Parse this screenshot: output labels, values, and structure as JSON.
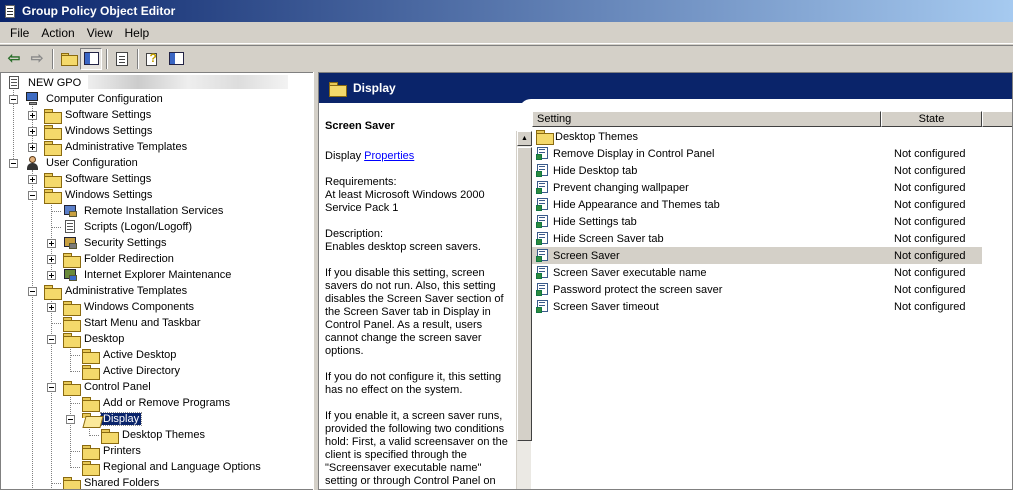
{
  "window": {
    "title": "Group Policy Object Editor"
  },
  "menu": [
    {
      "label": "File"
    },
    {
      "label": "Action"
    },
    {
      "label": "View"
    },
    {
      "label": "Help"
    }
  ],
  "toolbar": {
    "buttons": [
      "back-icon",
      "forward-icon",
      "up-folder-icon",
      "show-hide-tree-icon",
      "export-list-icon",
      "help-icon",
      "properties-icon"
    ]
  },
  "tree": {
    "root": "NEW GPO",
    "items": [
      {
        "label": "Computer Configuration"
      },
      {
        "label": "Software Settings"
      },
      {
        "label": "Windows Settings"
      },
      {
        "label": "Administrative Templates"
      },
      {
        "label": "User Configuration"
      },
      {
        "label": "Software Settings"
      },
      {
        "label": "Windows Settings"
      },
      {
        "label": "Remote Installation Services"
      },
      {
        "label": "Scripts (Logon/Logoff)"
      },
      {
        "label": "Security Settings"
      },
      {
        "label": "Folder Redirection"
      },
      {
        "label": "Internet Explorer Maintenance"
      },
      {
        "label": "Administrative Templates"
      },
      {
        "label": "Windows Components"
      },
      {
        "label": "Start Menu and Taskbar"
      },
      {
        "label": "Desktop"
      },
      {
        "label": "Active Desktop"
      },
      {
        "label": "Active Directory"
      },
      {
        "label": "Control Panel"
      },
      {
        "label": "Add or Remove Programs"
      },
      {
        "label": "Display"
      },
      {
        "label": "Desktop Themes"
      },
      {
        "label": "Printers"
      },
      {
        "label": "Regional and Language Options"
      },
      {
        "label": "Shared Folders"
      }
    ]
  },
  "details": {
    "header": "Display",
    "setting_title": "Screen Saver",
    "display_prefix": "Display",
    "properties_link": "Properties",
    "requirements_label": "Requirements:",
    "requirements_text": "At least Microsoft Windows 2000 Service Pack 1",
    "description_label": "Description:",
    "description_text": "Enables desktop screen savers.",
    "para1": "If you disable this setting, screen savers do not run. Also, this setting disables the Screen Saver section of the Screen Saver tab in Display in Control Panel. As a result, users cannot change the screen saver options.",
    "para2": "If you do not configure it, this setting has no effect on the system.",
    "para3": "If you enable it, a screen saver runs, provided the following two conditions hold: First, a valid screensaver on the client is specified through the \"Screensaver executable name\" setting or through Control Panel on the client computer. Second, the"
  },
  "list": {
    "columns": [
      "Setting",
      "State"
    ],
    "rows": [
      {
        "name": "Desktop Themes",
        "state": "",
        "type": "folder"
      },
      {
        "name": "Remove Display in Control Panel",
        "state": "Not configured",
        "type": "setting"
      },
      {
        "name": "Hide Desktop tab",
        "state": "Not configured",
        "type": "setting"
      },
      {
        "name": "Prevent changing wallpaper",
        "state": "Not configured",
        "type": "setting"
      },
      {
        "name": "Hide Appearance and Themes tab",
        "state": "Not configured",
        "type": "setting"
      },
      {
        "name": "Hide Settings tab",
        "state": "Not configured",
        "type": "setting"
      },
      {
        "name": "Hide Screen Saver tab",
        "state": "Not configured",
        "type": "setting"
      },
      {
        "name": "Screen Saver",
        "state": "Not configured",
        "type": "setting"
      },
      {
        "name": "Screen Saver executable name",
        "state": "Not configured",
        "type": "setting"
      },
      {
        "name": "Password protect the screen saver",
        "state": "Not configured",
        "type": "setting"
      },
      {
        "name": "Screen Saver timeout",
        "state": "Not configured",
        "type": "setting"
      }
    ]
  }
}
